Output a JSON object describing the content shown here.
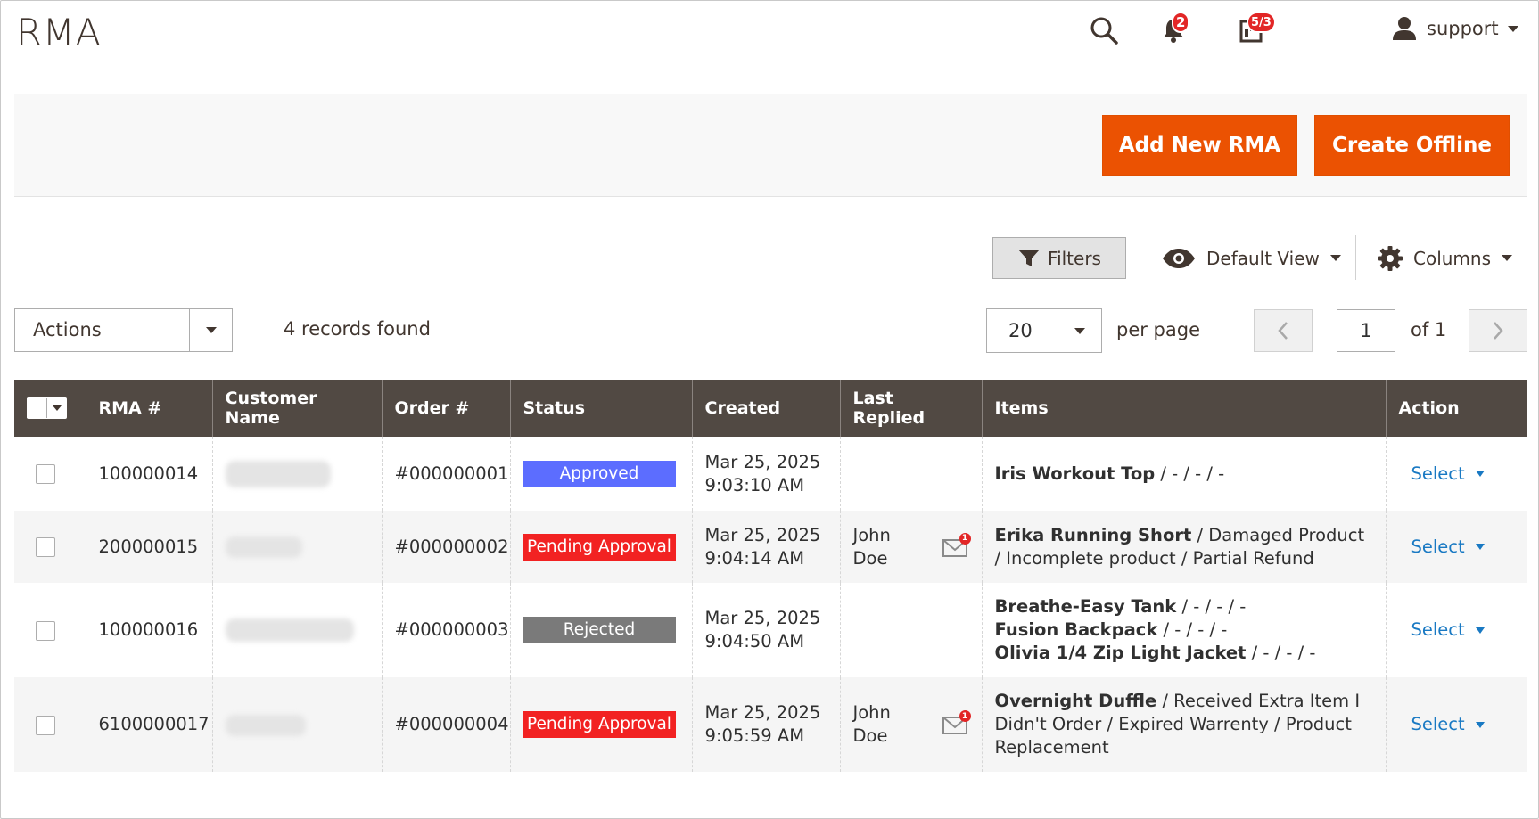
{
  "header": {
    "title": "RMA",
    "notifications_count": "2",
    "messages_count": "5/3",
    "user": "support"
  },
  "buttons": {
    "add_new": "Add New RMA",
    "create_offline": "Create Offline"
  },
  "toolbar": {
    "filters": "Filters",
    "view": "Default View",
    "columns": "Columns",
    "actions": "Actions",
    "records": "4 records found",
    "per_page_value": "20",
    "per_page_label": "per page",
    "page": "1",
    "of_pages": "of 1"
  },
  "grid": {
    "columns": [
      "RMA #",
      "Customer Name",
      "Order #",
      "Status",
      "Created",
      "Last Replied",
      "Items",
      "Action"
    ],
    "rows": [
      {
        "rma": "100000014",
        "order": "#000000001",
        "status": "Approved",
        "status_color": "#5c6dff",
        "created_date": "Mar 25, 2025",
        "created_time": "9:03:10 AM",
        "last_replied": "",
        "items": [
          {
            "name": "Iris Workout Top",
            "meta": " / - / - / -"
          }
        ],
        "action": "Select"
      },
      {
        "rma": "200000015",
        "order": "#000000002",
        "status": "Pending Approval",
        "status_color": "#f22222",
        "created_date": "Mar 25, 2025",
        "created_time": "9:04:14 AM",
        "last_replied": "John Doe",
        "items": [
          {
            "name": "Erika Running Short",
            "meta": " / Damaged Product / Incomplete product / Partial Refund"
          }
        ],
        "action": "Select"
      },
      {
        "rma": "100000016",
        "order": "#000000003",
        "status": "Rejected",
        "status_color": "#7a7a7a",
        "created_date": "Mar 25, 2025",
        "created_time": "9:04:50 AM",
        "last_replied": "",
        "items": [
          {
            "name": "Breathe-Easy Tank",
            "meta": " / - / - / -"
          },
          {
            "name": "Fusion Backpack",
            "meta": " / - / - / -"
          },
          {
            "name": "Olivia 1/4 Zip Light Jacket",
            "meta": " / - / - / -"
          }
        ],
        "action": "Select"
      },
      {
        "rma": "6100000017",
        "order": "#000000004",
        "status": "Pending Approval",
        "status_color": "#f22222",
        "created_date": "Mar 25, 2025",
        "created_time": "9:05:59 AM",
        "last_replied": "John Doe",
        "items": [
          {
            "name": "Overnight Duffle",
            "meta": " / Received Extra Item I Didn't Order / Expired Warrenty / Product Replacement"
          }
        ],
        "action": "Select"
      }
    ]
  },
  "colors": {
    "accent": "#eb5202",
    "grid_header": "#514943",
    "link": "#1979c3"
  }
}
